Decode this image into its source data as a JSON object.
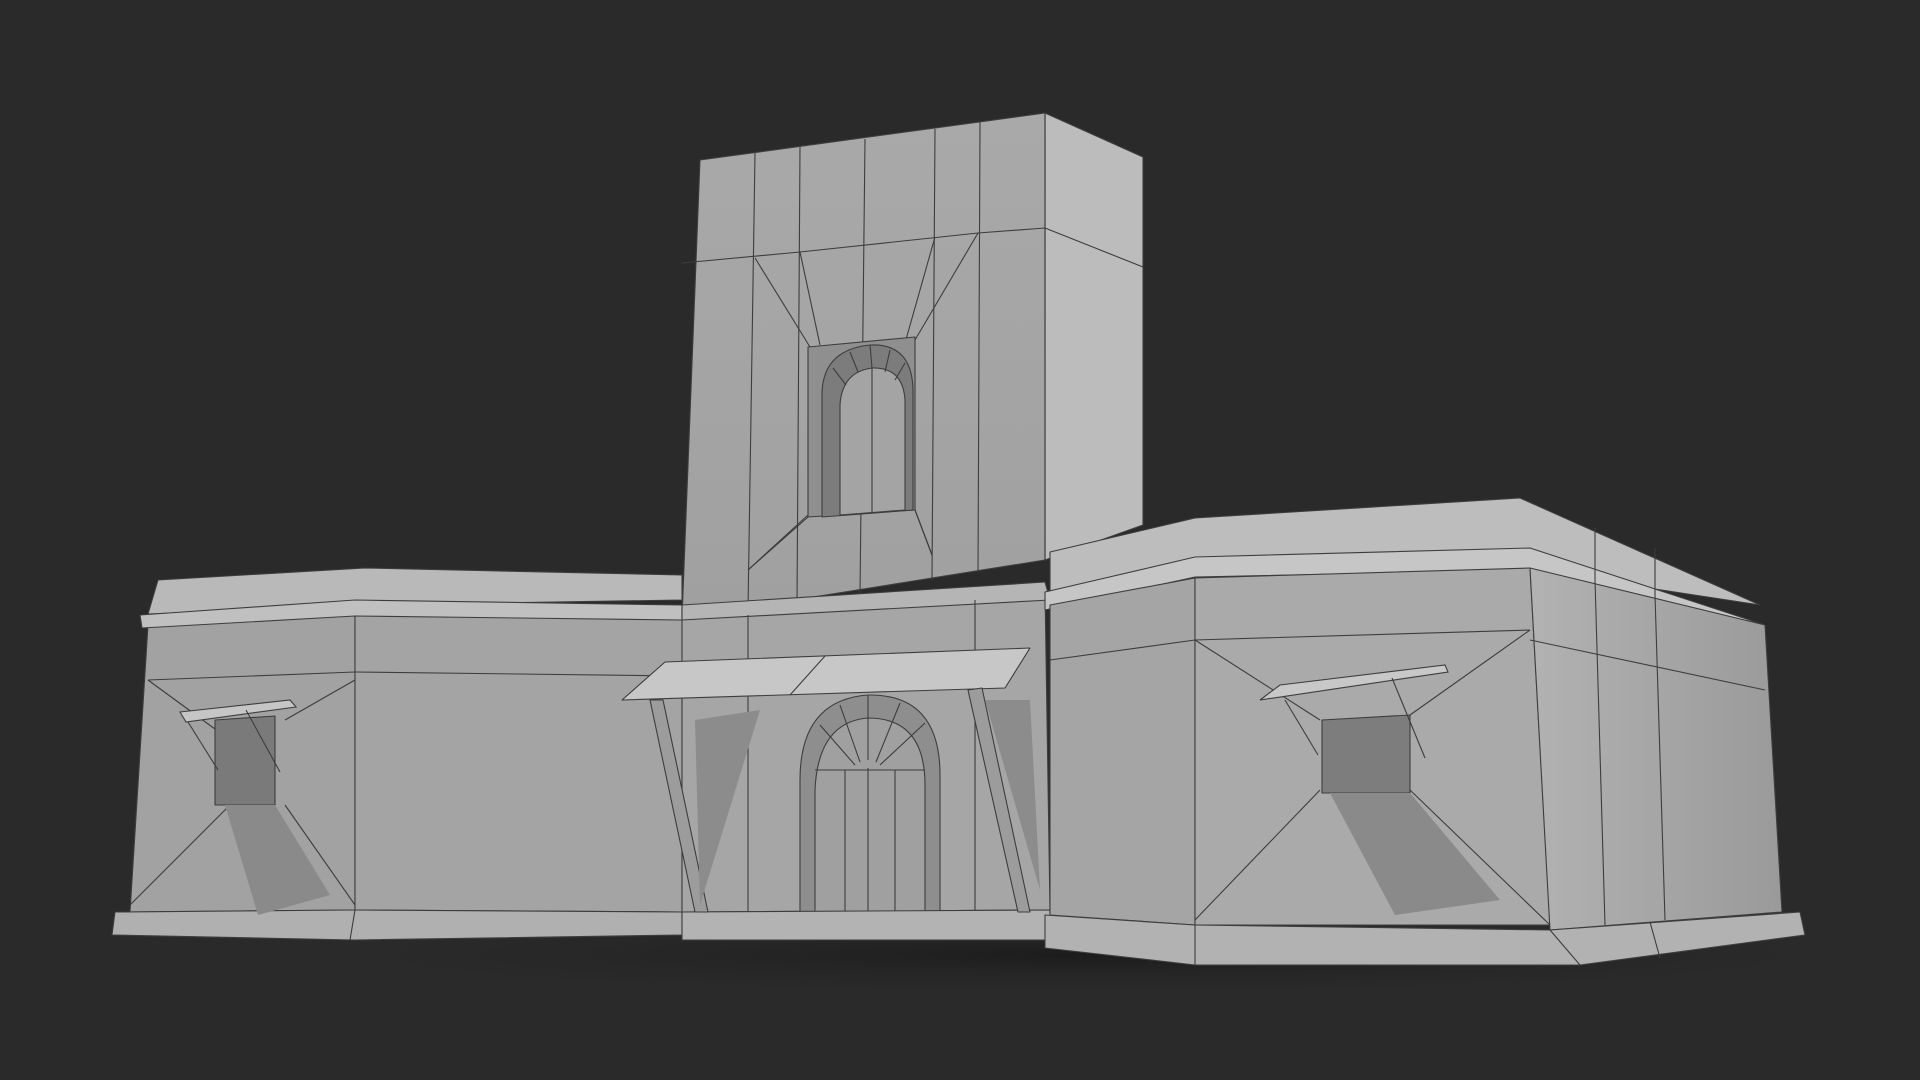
{
  "colors": {
    "background": "#2a2a2a",
    "wall_lit": "#a9a9a9",
    "wall_front": "#9a9a9a",
    "wall_shadow": "#6f6f6f",
    "roof_top": "#b8b8b8",
    "edge_line": "#3a3a3a",
    "ground_shadow": "#1c1c1c"
  },
  "subject": {
    "kind": "grey-shaded wireframe render of a building model",
    "elements": [
      "central-tower",
      "left-wing",
      "right-wing",
      "entrance-awning",
      "entrance-arch",
      "tower-arched-window",
      "left-window-awning",
      "right-window-awning"
    ]
  }
}
